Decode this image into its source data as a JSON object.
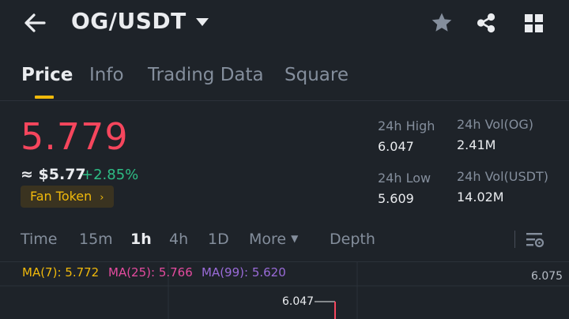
{
  "header": {
    "title": "OG/USDT",
    "icons": {
      "back": "arrow-left-icon",
      "caret": "caret-down-icon",
      "favorite": "star-icon",
      "share": "share-icon",
      "menu": "grid-icon"
    }
  },
  "tabs": [
    {
      "label": "Price",
      "active": true
    },
    {
      "label": "Info",
      "active": false
    },
    {
      "label": "Trading Data",
      "active": false
    },
    {
      "label": "Square",
      "active": false
    }
  ],
  "price": {
    "last": "5.779",
    "usd_equivalent": "≈ $5.77",
    "change": "+2.85%",
    "tag": "Fan Token",
    "tag_chevron": "›"
  },
  "stats": {
    "high": {
      "label": "24h High",
      "value": "6.047"
    },
    "low": {
      "label": "24h Low",
      "value": "5.609"
    },
    "vol_base": {
      "label": "24h Vol(OG)",
      "value": "2.41M"
    },
    "vol_quote": {
      "label": "24h Vol(USDT)",
      "value": "14.02M"
    }
  },
  "intervals": [
    {
      "label": "Time",
      "active": false
    },
    {
      "label": "15m",
      "active": false
    },
    {
      "label": "1h",
      "active": true
    },
    {
      "label": "4h",
      "active": false
    },
    {
      "label": "1D",
      "active": false
    },
    {
      "label": "More",
      "active": false
    },
    {
      "label": "Depth",
      "active": false
    }
  ],
  "chart": {
    "ma": [
      {
        "label": "MA(7): 5.772",
        "color": "#f0b90b"
      },
      {
        "label": "MA(25): 5.766",
        "color": "#e44b9f"
      },
      {
        "label": "MA(99): 5.620",
        "color": "#9a6bd8"
      }
    ],
    "axis_top": "6.075",
    "high_marker": "6.047"
  },
  "colors": {
    "background": "#1e2329",
    "accent": "#f0b90b",
    "down": "#f6465d",
    "up": "#2ebd85",
    "muted": "#848e9c"
  }
}
